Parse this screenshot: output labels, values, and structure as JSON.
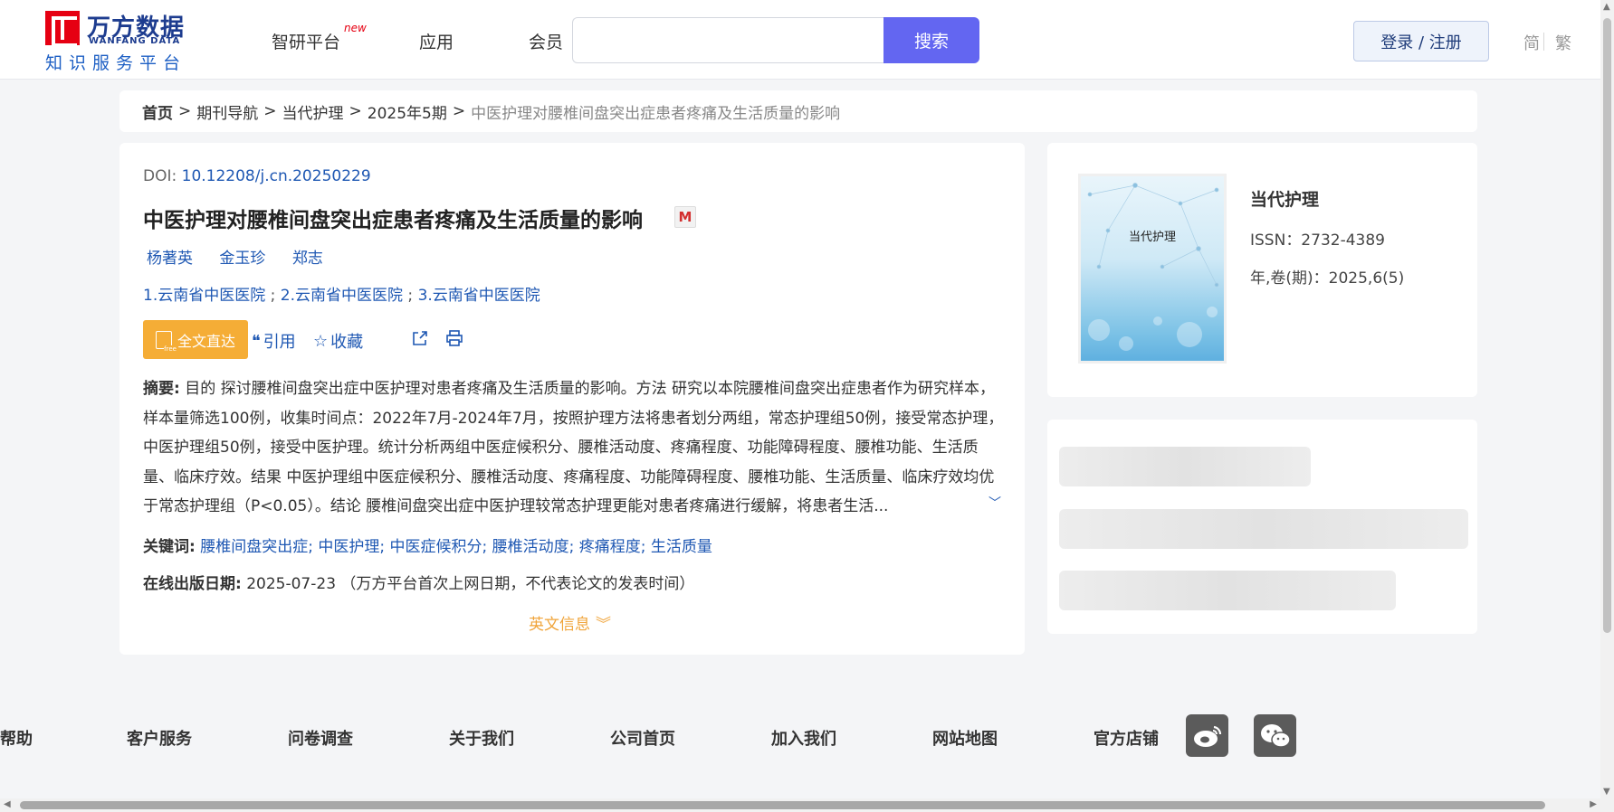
{
  "header": {
    "logo_cn": "万方数据",
    "logo_en": "WANFANG DATA",
    "logo_sub": "知识服务平台",
    "nav": [
      {
        "label": "智研平台"
      },
      {
        "label": "应用"
      },
      {
        "label": "会员"
      }
    ],
    "nav_new_badge": "new",
    "search_value": "",
    "search_button": "搜索",
    "login_button": "登录 / 注册",
    "lang_simplified": "简",
    "lang_traditional": "繁"
  },
  "breadcrumb": {
    "home": "首页",
    "items": [
      "期刊导航",
      "当代护理",
      "2025年5期"
    ],
    "current": "中医护理对腰椎间盘突出症患者疼痛及生活质量的影响",
    "separator": ">"
  },
  "article": {
    "doi_label": "DOI: ",
    "doi": "10.12208/j.cn.20250229",
    "title": "中医护理对腰椎间盘突出症患者疼痛及生活质量的影响",
    "title_badge": "M",
    "authors": [
      "杨著英",
      "金玉珍",
      "郑志"
    ],
    "orgs": [
      "1.云南省中医医院",
      "2.云南省中医医院",
      "3.云南省中医医院"
    ],
    "org_separator": ";",
    "fulltext_button": "全文直达",
    "cite_label": "引用",
    "favorite_label": "收藏",
    "abstract_label": "摘要:",
    "abstract": "目的 探讨腰椎间盘突出症中医护理对患者疼痛及生活质量的影响。方法 研究以本院腰椎间盘突出症患者作为研究样本，样本量筛选100例，收集时间点：2022年7月-2024年7月，按照护理方法将患者划分两组，常态护理组50例，接受常态护理，中医护理组50例，接受中医护理。统计分析两组中医症候积分、腰椎活动度、疼痛程度、功能障碍程度、腰椎功能、生活质量、临床疗效。结果 中医护理组中医症候积分、腰椎活动度、疼痛程度、功能障碍程度、腰椎功能、生活质量、临床疗效均优于常态护理组（P<0.05）。结论 腰椎间盘突出症中医护理较常态护理更能对患者疼痛进行缓解，将患者生活...",
    "keywords_label": "关键词:",
    "keywords": [
      "腰椎间盘突出症",
      "中医护理",
      "中医症候积分",
      "腰椎活动度",
      "疼痛程度",
      "生活质量"
    ],
    "pubdate_label": "在线出版日期:",
    "pubdate": "2025-07-23",
    "pubdate_note": "（万方平台首次上网日期，不代表论文的发表时间）",
    "english_info": "英文信息"
  },
  "journal": {
    "cover_title": "当代护理",
    "name": "当代护理",
    "issn": "ISSN：2732-4389",
    "volume": "年,卷(期)：2025,6(5)"
  },
  "footer": {
    "links": [
      "帮助",
      "客户服务",
      "问卷调查",
      "关于我们",
      "公司首页",
      "加入我们",
      "网站地图",
      "官方店铺"
    ]
  },
  "icons": {
    "cite": "quote-icon",
    "favorite": "star-icon",
    "share": "share-icon",
    "print": "print-icon",
    "expand": "chevron-down-icon",
    "weibo": "weibo-icon",
    "wechat": "wechat-icon"
  },
  "colors": {
    "primary_link": "#1f58b3",
    "search_button": "#6366f1",
    "fulltext_button": "#f5ad36",
    "english_info": "#f0a43a",
    "logo_red": "#e60012"
  }
}
